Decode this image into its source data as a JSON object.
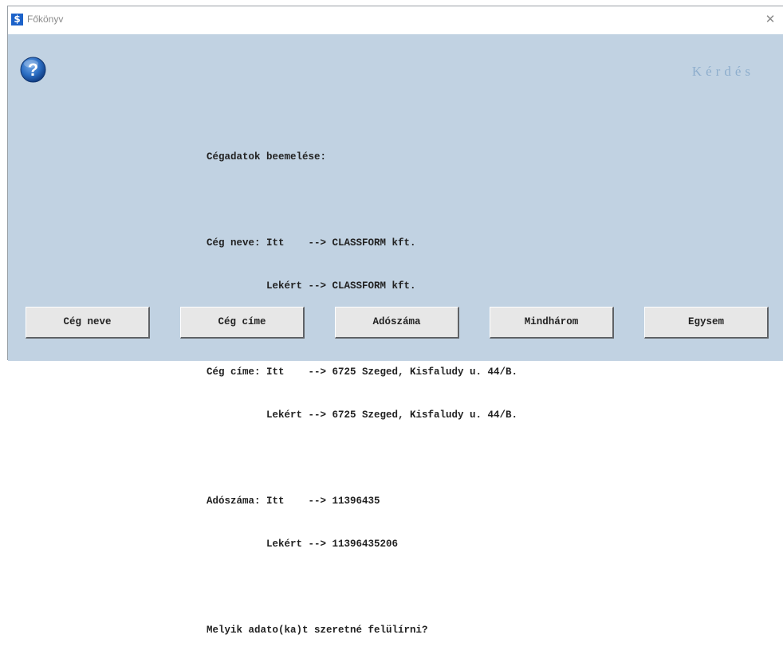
{
  "window": {
    "title": "Főkönyv",
    "app_icon_glyph": "$",
    "close_glyph": "✕"
  },
  "dialog": {
    "header_label": "Kérdés",
    "icon": "question-icon",
    "message_lines": [
      "Cégadatok beemelése:",
      "",
      "Cég neve: Itt    --> CLASSFORM kft.",
      "          Lekért --> CLASSFORM kft.",
      "",
      "Cég címe: Itt    --> 6725 Szeged, Kisfaludy u. 44/B.",
      "          Lekért --> 6725 Szeged, Kisfaludy u. 44/B.",
      "",
      "Adószáma: Itt    --> 11396435",
      "          Lekért --> 11396435206",
      "",
      "Melyik adato(ka)t szeretné felülírni?"
    ],
    "buttons": [
      "Cég neve",
      "Cég címe",
      "Adószáma",
      "Mindhárom",
      "Egysem"
    ]
  },
  "colors": {
    "client_background": "#c1d2e2",
    "header_label": "#8eaecd",
    "app_icon": "#1c62c9"
  }
}
